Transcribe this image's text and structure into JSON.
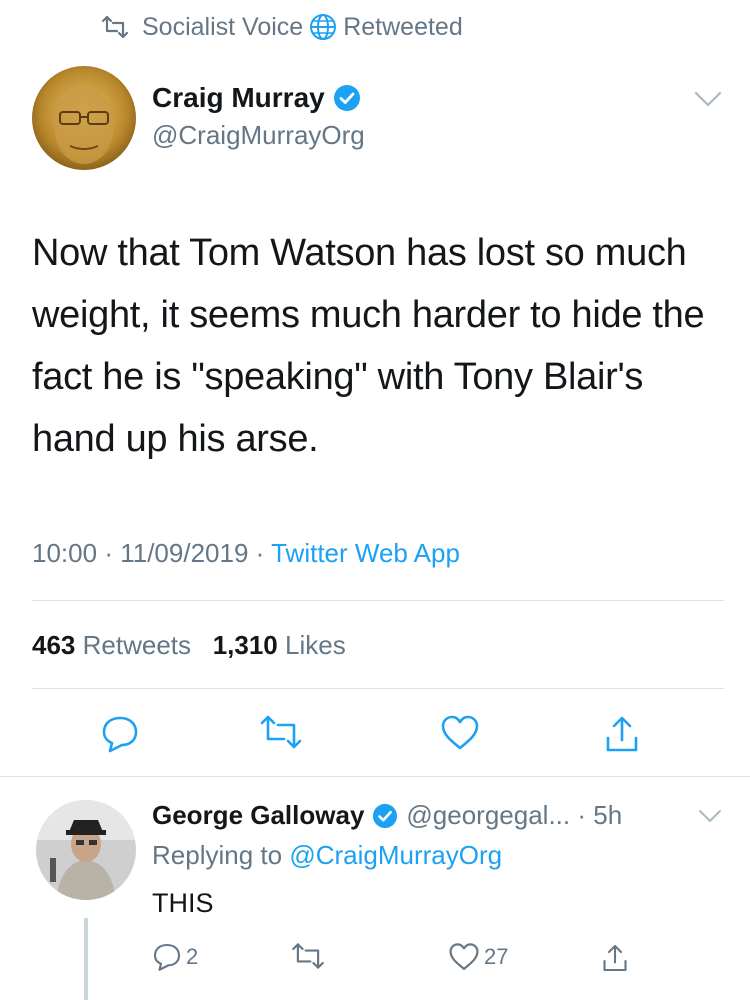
{
  "retweet_context": {
    "account": "Socialist Voice",
    "label": "Retweeted"
  },
  "tweet": {
    "author_name": "Craig Murray",
    "author_handle": "@CraigMurrayOrg",
    "text": "Now that Tom Watson has lost so much weight, it seems much harder to hide the fact he is \"speaking\" with Tony Blair's hand up his arse.",
    "time": "10:00",
    "date": "11/09/2019",
    "source": "Twitter Web App",
    "retweets_count": "463",
    "retweets_label": "Retweets",
    "likes_count": "1,310",
    "likes_label": "Likes"
  },
  "reply": {
    "author_name": "George Galloway",
    "author_handle": "@georgegal...",
    "time": "5h",
    "replying_prefix": "Replying to",
    "replying_handle": "@CraigMurrayOrg",
    "text": "THIS",
    "reply_count": "2",
    "like_count": "27"
  },
  "colors": {
    "accent": "#1da1f2",
    "muted": "#657786",
    "text": "#14171a",
    "divider": "#dfe3e7"
  },
  "icons": [
    "retweet-icon",
    "globe-icon",
    "verified-badge-icon",
    "chevron-down-icon",
    "reply-icon",
    "heart-icon",
    "share-icon"
  ]
}
